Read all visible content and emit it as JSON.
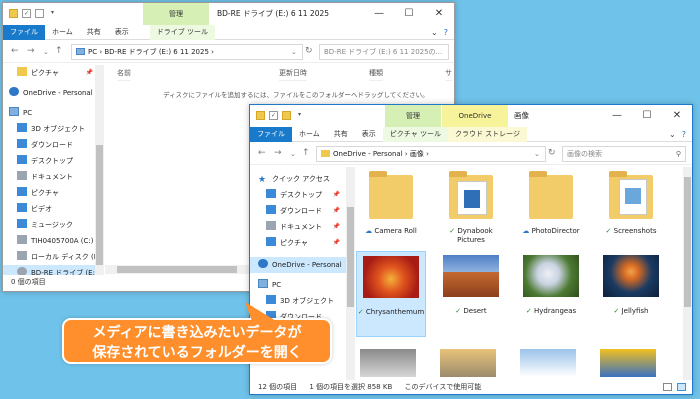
{
  "window1": {
    "context_tab": "管理",
    "title": "BD-RE ドライブ (E:) 6 11 2025",
    "ribbon_tabs": [
      "ファイル",
      "ホーム",
      "共有",
      "表示",
      "ドライブ ツール"
    ],
    "address": "PC  ›  BD-RE ドライブ (E:) 6 11 2025  ›",
    "search_placeholder": "BD-RE ドライブ (E:) 6 11 2025の...",
    "columns": [
      "名前",
      "更新日時",
      "種類",
      "サ"
    ],
    "empty_message": "ディスクにファイルを追加するには、ファイルをこのフォルダーへドラッグしてください。",
    "sidebar": [
      {
        "label": "ピクチャ",
        "icon": "pictures-icon",
        "pin": true
      },
      {
        "label": "OneDrive - Personal",
        "icon": "cloud-icon"
      },
      {
        "label": "PC",
        "icon": "pc-icon"
      },
      {
        "label": "3D オブジェクト",
        "icon": "3d-objects-icon"
      },
      {
        "label": "ダウンロード",
        "icon": "download-icon"
      },
      {
        "label": "デスクトップ",
        "icon": "desktop-icon"
      },
      {
        "label": "ドキュメント",
        "icon": "documents-icon"
      },
      {
        "label": "ピクチャ",
        "icon": "pictures-icon"
      },
      {
        "label": "ビデオ",
        "icon": "video-icon"
      },
      {
        "label": "ミュージック",
        "icon": "music-icon"
      },
      {
        "label": "TIH0405700A (C:)",
        "icon": "drive-icon"
      },
      {
        "label": "ローカル ディスク (D:)",
        "icon": "drive-icon"
      },
      {
        "label": "BD-RE ドライブ (E:)",
        "icon": "disc-drive-icon",
        "selected": true
      }
    ],
    "status": "0 個の項目"
  },
  "window2": {
    "context_tabs": [
      "管理",
      "OneDrive"
    ],
    "title": "画像",
    "ribbon_tabs": [
      "ファイル",
      "ホーム",
      "共有",
      "表示",
      "ピクチャ ツール",
      "クラウド ストレージ"
    ],
    "address": "OneDrive - Personal  ›  画像  ›",
    "search_placeholder": "画像の検索",
    "sidebar": [
      {
        "label": "クイック アクセス",
        "icon": "star-icon"
      },
      {
        "label": "デスクトップ",
        "icon": "desktop-icon",
        "pin": true
      },
      {
        "label": "ダウンロード",
        "icon": "download-icon",
        "pin": true
      },
      {
        "label": "ドキュメント",
        "icon": "documents-icon",
        "pin": true
      },
      {
        "label": "ピクチャ",
        "icon": "pictures-icon",
        "pin": true
      },
      {
        "label": "OneDrive - Personal",
        "icon": "cloud-icon",
        "selected": true
      },
      {
        "label": "PC",
        "icon": "pc-icon"
      },
      {
        "label": "3D オブジェクト",
        "icon": "3d-objects-icon"
      },
      {
        "label": "ダウンロード",
        "icon": "download-icon"
      }
    ],
    "items": [
      {
        "name": "Camera Roll",
        "status": "cloud",
        "kind": "folder"
      },
      {
        "name": "Dynabook Pictures",
        "status": "ok",
        "kind": "folder-docs"
      },
      {
        "name": "PhotoDirector",
        "status": "cloud",
        "kind": "folder"
      },
      {
        "name": "Screenshots",
        "status": "ok",
        "kind": "folder-docs"
      },
      {
        "name": "Chrysanthemum",
        "status": "ok",
        "kind": "photo",
        "color": "#c9301e",
        "selected": true
      },
      {
        "name": "Desert",
        "status": "ok",
        "kind": "photo",
        "color": "#b85c2c"
      },
      {
        "name": "Hydrangeas",
        "status": "ok",
        "kind": "photo",
        "color": "#5e7f3a"
      },
      {
        "name": "Jellyfish",
        "status": "ok",
        "kind": "photo",
        "color": "#1b3558"
      }
    ],
    "status_count": "12 個の項目",
    "status_selected": "1 個の項目を選択  858 KB",
    "status_avail": "このデバイスで使用可能"
  },
  "callout": {
    "line1": "メディアに書き込みたいデータが",
    "line2": "保存されているフォルダーを開く"
  },
  "colors": {
    "accent": "#1979ca",
    "callout": "#ff8f2c",
    "context": "#d5efb4",
    "background": "#6fc3ea"
  }
}
